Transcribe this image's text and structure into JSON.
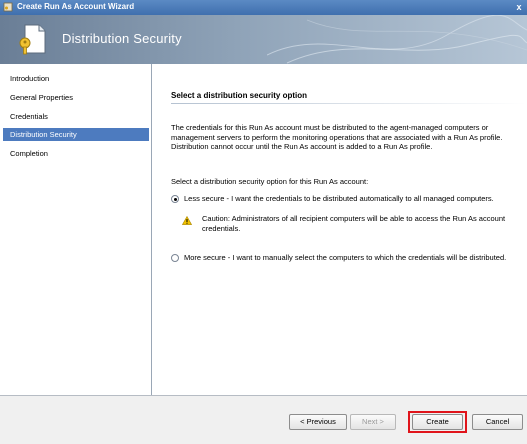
{
  "window": {
    "title": "Create Run As Account Wizard",
    "close_glyph": "x"
  },
  "banner": {
    "heading": "Distribution Security"
  },
  "nav": {
    "items": [
      {
        "label": "Introduction"
      },
      {
        "label": "General Properties"
      },
      {
        "label": "Credentials"
      },
      {
        "label": "Distribution Security",
        "selected": true
      },
      {
        "label": "Completion"
      }
    ]
  },
  "content": {
    "section_title": "Select a distribution security option",
    "description": "The credentials for this Run As account must be distributed to the agent-managed computers or management servers to perform the monitoring operations that are associated with a Run As profile. Distribution cannot occur until the Run As account is added to a Run As profile.",
    "prompt": "Select a distribution security option for this Run As account:",
    "options": [
      {
        "label": "Less secure - I want the credentials to be distributed automatically to all managed computers.",
        "checked": true
      },
      {
        "label": "More secure - I want to manually select the computers to which the credentials will be distributed.",
        "checked": false
      }
    ],
    "caution": "Caution: Administrators of all recipient computers will be able to access the Run As account credentials."
  },
  "buttons": {
    "previous": "< Previous",
    "next": "Next >",
    "create": "Create",
    "cancel": "Cancel"
  },
  "colors": {
    "title_bar": "#3f6fae",
    "selected_nav": "#4d7bbf",
    "highlight": "#e0141b",
    "warning": "#f2c200"
  },
  "icons": {
    "window": "wizard-app-icon",
    "banner": "document-key-icon",
    "caution": "warning-icon"
  }
}
